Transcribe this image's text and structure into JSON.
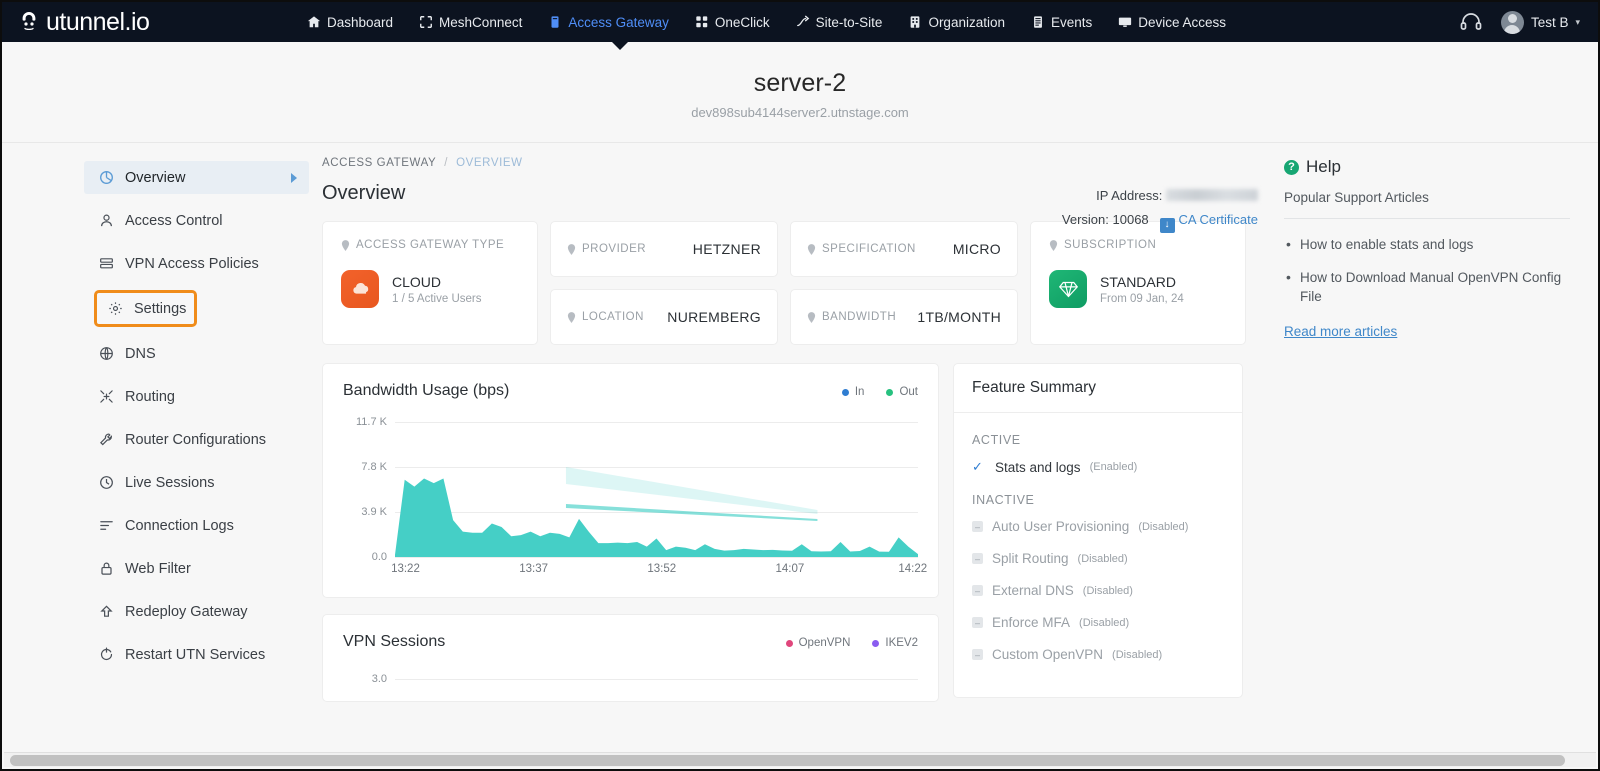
{
  "topnav": {
    "brand": "utunnel.io",
    "items": [
      {
        "label": "Dashboard",
        "icon": "home-icon",
        "active": false
      },
      {
        "label": "MeshConnect",
        "icon": "mesh-icon",
        "active": false
      },
      {
        "label": "Access Gateway",
        "icon": "gateway-icon",
        "active": true
      },
      {
        "label": "OneClick",
        "icon": "oneclick-icon",
        "active": false
      },
      {
        "label": "Site-to-Site",
        "icon": "site-to-site-icon",
        "active": false
      },
      {
        "label": "Organization",
        "icon": "building-icon",
        "active": false
      },
      {
        "label": "Events",
        "icon": "events-icon",
        "active": false
      },
      {
        "label": "Device Access",
        "icon": "monitor-icon",
        "active": false
      }
    ],
    "support_icon": "headset-icon",
    "user": "Test B",
    "user_caret": "▾"
  },
  "pagehead": {
    "title": "server-2",
    "hostname": "dev898sub4144server2.utnstage.com"
  },
  "sidebar": {
    "items": [
      {
        "label": "Overview",
        "icon": "pie-chart-icon",
        "active": true,
        "arrow": true
      },
      {
        "label": "Access Control",
        "icon": "person-icon"
      },
      {
        "label": "VPN Access Policies",
        "icon": "list-icon"
      },
      {
        "label": "Settings",
        "icon": "gear-icon",
        "highlighted": true
      },
      {
        "label": "DNS",
        "icon": "globe-icon"
      },
      {
        "label": "Routing",
        "icon": "routing-icon"
      },
      {
        "label": "Router Configurations",
        "icon": "wrench-icon"
      },
      {
        "label": "Live Sessions",
        "icon": "clock-icon"
      },
      {
        "label": "Connection Logs",
        "icon": "logs-icon"
      },
      {
        "label": "Web Filter",
        "icon": "lock-icon"
      },
      {
        "label": "Redeploy Gateway",
        "icon": "redeploy-icon"
      },
      {
        "label": "Restart UTN Services",
        "icon": "restart-icon"
      }
    ]
  },
  "breadcrumb": {
    "parent": "ACCESS GATEWAY",
    "separator": "/",
    "current": "OVERVIEW"
  },
  "main": {
    "title": "Overview"
  },
  "meta": {
    "ip_label": "IP Address:",
    "ip_value": "",
    "version_label": "Version:",
    "version_value": "10068",
    "cert_link": "CA Certificate",
    "cert_icon": "download-icon"
  },
  "cards": {
    "gateway_type": {
      "label": "ACCESS GATEWAY TYPE",
      "icon": "cloud-icon",
      "value": "CLOUD",
      "sub": "1 / 5 Active Users"
    },
    "provider": {
      "label": "PROVIDER",
      "value": "HETZNER"
    },
    "location": {
      "label": "LOCATION",
      "value": "NUREMBERG"
    },
    "specification": {
      "label": "SPECIFICATION",
      "value": "MICRO"
    },
    "bandwidth": {
      "label": "BANDWIDTH",
      "value": "1TB/MONTH"
    },
    "subscription": {
      "label": "SUBSCRIPTION",
      "icon": "gem-icon",
      "value": "STANDARD",
      "sub": "From 09 Jan, 24"
    }
  },
  "chart_data": [
    {
      "type": "area",
      "title": "Bandwidth Usage (bps)",
      "xlabel": "",
      "ylabel": "",
      "ylim": [
        0,
        11700
      ],
      "yticks": [
        "0.0",
        "3.9 K",
        "7.8 K",
        "11.7 K"
      ],
      "ytick_values": [
        0,
        3900,
        7800,
        11700
      ],
      "xticks": [
        "13:22",
        "13:37",
        "13:52",
        "14:07",
        "14:22"
      ],
      "grid": true,
      "legend_position": "top-right",
      "legend": [
        {
          "name": "In",
          "color": "#2f7dd1"
        },
        {
          "name": "Out",
          "color": "#27c17f"
        }
      ],
      "area_color": "#45cfc6",
      "series": [
        {
          "name": "Out",
          "values": [
            200,
            6700,
            6100,
            6800,
            6400,
            6800,
            3200,
            2200,
            2100,
            2100,
            2900,
            2600,
            1800,
            1900,
            2200,
            1800,
            2100,
            2000,
            1700,
            3300,
            2200,
            1200,
            1200,
            1250,
            1200,
            1300,
            900,
            1600,
            600,
            900,
            800,
            600,
            1100,
            700,
            550,
            600,
            700,
            650,
            600,
            620,
            560,
            540,
            1100,
            500,
            480,
            500,
            1300,
            480,
            520,
            900,
            470,
            450,
            1700,
            900,
            250
          ]
        }
      ]
    },
    {
      "type": "area",
      "title": "VPN Sessions",
      "ylim": [
        0,
        3
      ],
      "yticks": [
        "3.0"
      ],
      "grid": true,
      "legend_position": "top-right",
      "legend": [
        {
          "name": "OpenVPN",
          "color": "#e0467c"
        },
        {
          "name": "IKEV2",
          "color": "#8a5cf0"
        }
      ],
      "series": [
        {
          "name": "OpenVPN",
          "values": [
            0,
            0,
            0,
            0,
            0
          ]
        }
      ]
    }
  ],
  "feature_summary": {
    "title": "Feature Summary",
    "groups": [
      {
        "label": "ACTIVE",
        "items": [
          {
            "name": "Stats and logs",
            "state": "(Enabled)",
            "enabled": true
          }
        ]
      },
      {
        "label": "INACTIVE",
        "items": [
          {
            "name": "Auto User Provisioning",
            "state": "(Disabled)",
            "enabled": false
          },
          {
            "name": "Split Routing",
            "state": "(Disabled)",
            "enabled": false
          },
          {
            "name": "External DNS",
            "state": "(Disabled)",
            "enabled": false
          },
          {
            "name": "Enforce MFA",
            "state": "(Disabled)",
            "enabled": false
          },
          {
            "name": "Custom OpenVPN",
            "state": "(Disabled)",
            "enabled": false
          }
        ]
      }
    ]
  },
  "help": {
    "title": "Help",
    "subtitle": "Popular Support Articles",
    "articles": [
      "How to enable stats and logs",
      "How to Download Manual OpenVPN Config File"
    ],
    "more_link": "Read more articles"
  },
  "colors": {
    "nav_bg": "#0c1320",
    "nav_active": "#4f8ef7",
    "highlight_box": "#f08c1a",
    "teal_area": "#45cfc6",
    "link_blue": "#3f87c9",
    "green": "#17a673"
  }
}
